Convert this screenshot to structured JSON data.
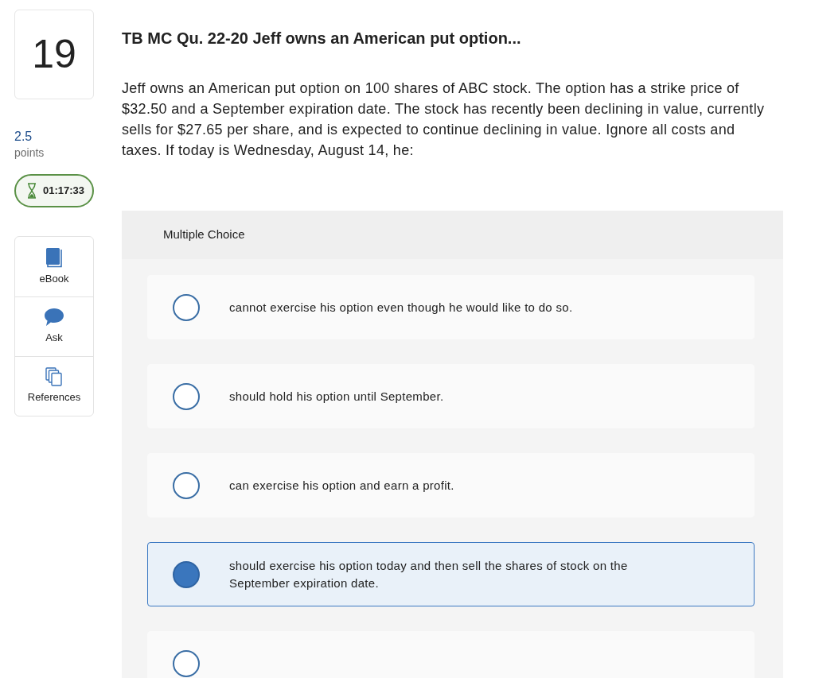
{
  "question": {
    "number": "19",
    "points": "2.5",
    "points_label": "points",
    "timer": "01:17:33",
    "title": "TB MC Qu. 22-20 Jeff owns an American put option...",
    "text": "Jeff owns an American put option on 100 shares of ABC stock. The option has a strike price of $32.50 and a September expiration date. The stock has recently been declining in value, currently sells for $27.65 per share, and is expected to continue declining in value. Ignore all costs and taxes. If today is Wednesday, August 14, he:"
  },
  "tools": [
    {
      "label": "eBook",
      "kind": "book"
    },
    {
      "label": "Ask",
      "kind": "chat"
    },
    {
      "label": "References",
      "kind": "references"
    }
  ],
  "answer": {
    "type_label": "Multiple Choice",
    "options": [
      {
        "text": "cannot exercise his option even though he would like to do so.",
        "selected": false
      },
      {
        "text": "should hold his option until September.",
        "selected": false
      },
      {
        "text": "can exercise his option and earn a profit.",
        "selected": false
      },
      {
        "text": "should exercise his option today and then sell the shares of stock on the September expiration date.",
        "selected": true
      },
      {
        "selected": false
      }
    ]
  }
}
